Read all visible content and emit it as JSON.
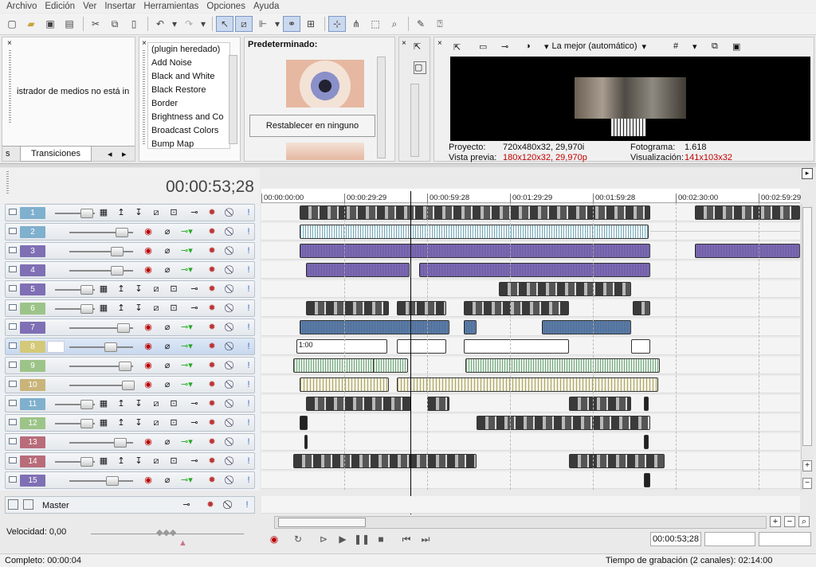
{
  "menu": [
    "Archivo",
    "Edición",
    "Ver",
    "Insertar",
    "Herramientas",
    "Opciones",
    "Ayuda"
  ],
  "explorer": {
    "text": "istrador de medios no está in",
    "tabs": [
      "s",
      "Transiciones"
    ]
  },
  "plugins": {
    "items": [
      "(plugin heredado)",
      "Add Noise",
      "Black and White",
      "Black Restore",
      "Border",
      "Brightness and Co",
      "Broadcast Colors",
      "Bump Map"
    ]
  },
  "preset": {
    "title": "Predeterminado:",
    "reset_label": "Restablecer en ninguno"
  },
  "preview": {
    "quality": "La mejor (automático)",
    "project_label": "Proyecto:",
    "project_value": "720x480x32, 29,970i",
    "frame_label": "Fotograma:",
    "frame_value": "1.618",
    "preview_label": "Vista previa:",
    "preview_value": "180x120x32, 29,970p",
    "display_label": "Visualización:",
    "display_value": "141x103x32",
    "accent_red": "#c00000"
  },
  "timeline": {
    "timecode": "00:00:53;28",
    "ruler": [
      "00:00:00:00",
      "00:00:29:29",
      "00:00:59:28",
      "00:01:29:29",
      "00:01:59:28",
      "00:02:30:00",
      "00:02:59:29"
    ],
    "marker_label": "1:00",
    "tracks": [
      {
        "num": "1",
        "kind": "v",
        "type": "video"
      },
      {
        "num": "2",
        "kind": "v",
        "type": "audio"
      },
      {
        "num": "3",
        "kind": "a",
        "type": "audio"
      },
      {
        "num": "4",
        "kind": "a",
        "type": "audio"
      },
      {
        "num": "5",
        "kind": "a",
        "type": "video"
      },
      {
        "num": "6",
        "kind": "g",
        "type": "video"
      },
      {
        "num": "7",
        "kind": "a",
        "type": "audio"
      },
      {
        "num": "8",
        "kind": "s",
        "type": "audio"
      },
      {
        "num": "9",
        "kind": "g",
        "type": "audio"
      },
      {
        "num": "10",
        "kind": "o",
        "type": "audio"
      },
      {
        "num": "11",
        "kind": "v",
        "type": "video"
      },
      {
        "num": "12",
        "kind": "g",
        "type": "video"
      },
      {
        "num": "13",
        "kind": "r",
        "type": "audio"
      },
      {
        "num": "14",
        "kind": "g",
        "type": "video"
      },
      {
        "num": "15",
        "kind": "a",
        "type": "audio"
      }
    ],
    "master_label": "Master"
  },
  "transport": {
    "rate_label": "Velocidad: 0,00",
    "time_display": "00:00:53;28"
  },
  "status": {
    "left": "Completo: 00:00:04",
    "right": "Tiempo de grabación (2 canales): 02:14:00"
  }
}
